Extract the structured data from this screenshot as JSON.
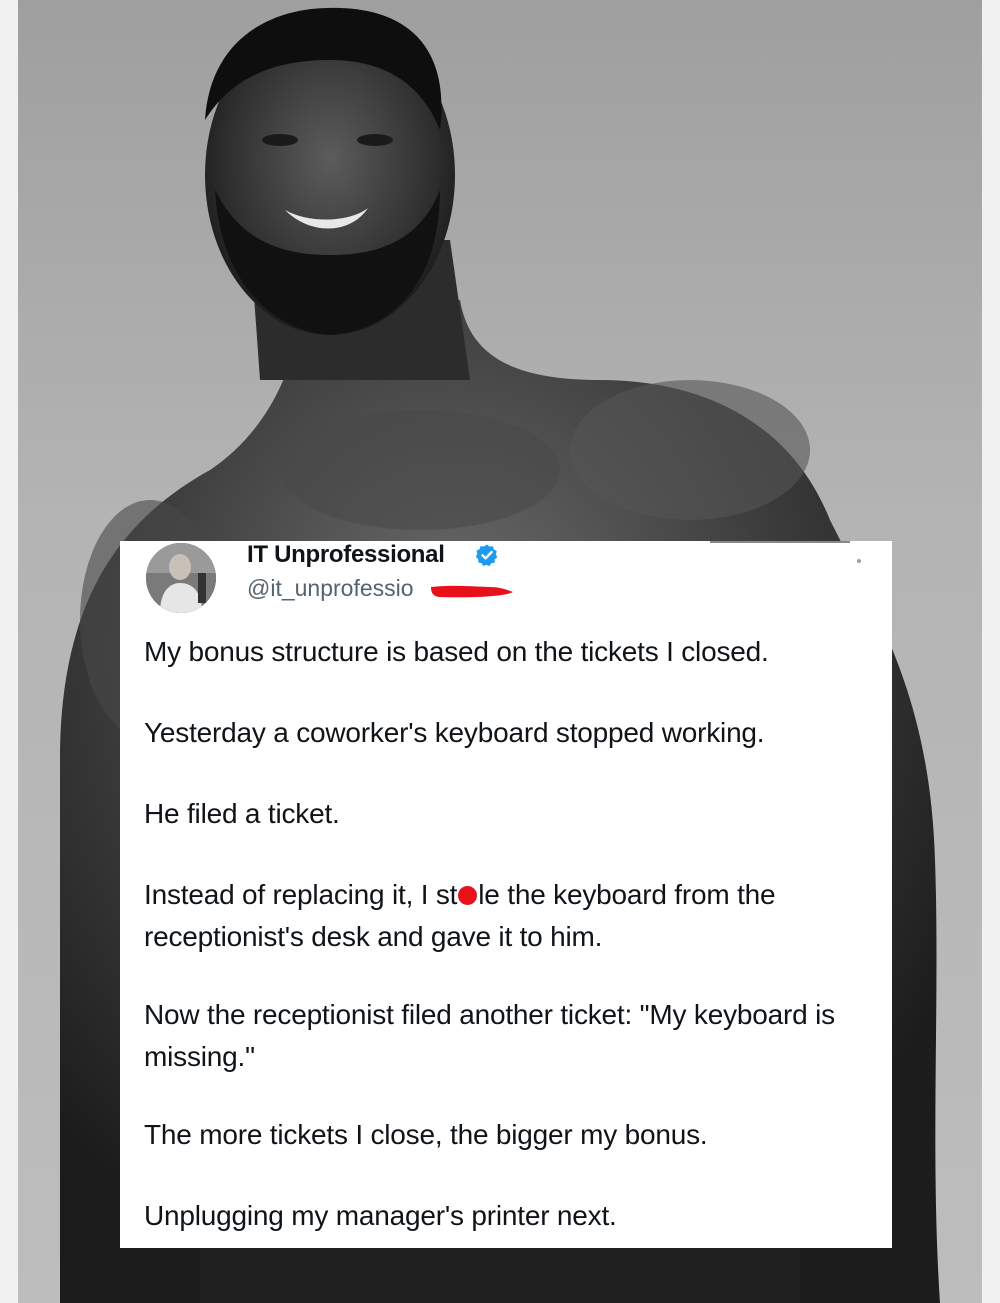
{
  "tweet": {
    "display_name": "IT Unprofessional",
    "handle": "@it_unprofessio",
    "verified": true,
    "paragraphs": [
      "My bonus structure is based on the tickets I closed.",
      "Yesterday a coworker's keyboard stopped working.",
      "He filed a ticket.",
      "",
      "Now the receptionist filed another ticket: \"My keyboard is missing.\"",
      "The more tickets I close, the bigger my bonus.",
      "Unplugging my manager's printer next."
    ],
    "paragraph_4": {
      "before_mark": "Instead of replacing it, I st",
      "after_mark": "le the keyboard from the receptionist's desk and gave it to him."
    }
  },
  "colors": {
    "text_primary": "#0f1419",
    "text_secondary": "#536471",
    "verified_blue": "#1d9bf0",
    "red_annotation": "#e8101a"
  },
  "icons": [
    "verified-badge-icon",
    "more-options-icon"
  ]
}
